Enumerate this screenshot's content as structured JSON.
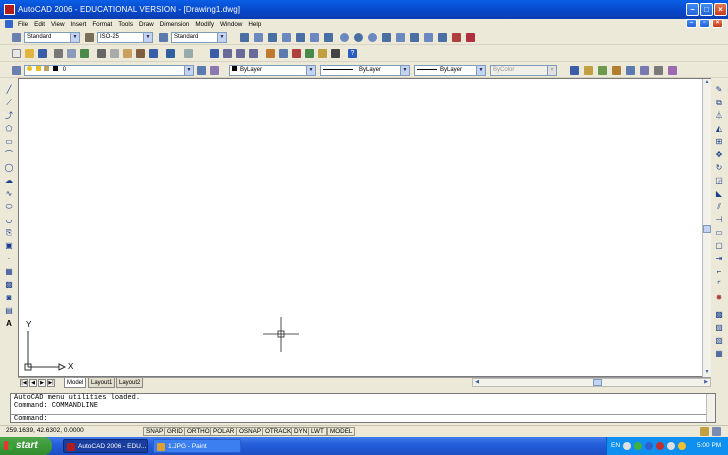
{
  "window": {
    "title": "AutoCAD 2006 - EDUCATIONAL VERSION - [Drawing1.dwg]"
  },
  "menu": [
    "File",
    "Edit",
    "View",
    "Insert",
    "Format",
    "Tools",
    "Draw",
    "Dimension",
    "Modify",
    "Window",
    "Help"
  ],
  "styles": {
    "text_style": "Standard",
    "dim_style": "ISO-25",
    "table_style": "Standard"
  },
  "layers": {
    "current": "0"
  },
  "properties": {
    "color": "ByLayer",
    "linetype": "ByLayer",
    "lineweight": "ByLayer",
    "plotstyle": "ByColor"
  },
  "ucs": {
    "y_label": "Y",
    "x_label": "X"
  },
  "tabs": [
    "Model",
    "Layout1",
    "Layout2"
  ],
  "command": {
    "history": [
      "AutoCAD menu utilities loaded.",
      "Command: COMMANDLINE"
    ],
    "prompt": "Command:"
  },
  "status": {
    "coords": "259.1639, 42.6302, 0.0000",
    "toggles": [
      "SNAP",
      "GRID",
      "ORTHO",
      "POLAR",
      "OSNAP",
      "OTRACK",
      "DYN",
      "LWT",
      "MODEL"
    ]
  },
  "taskbar": {
    "start": "start",
    "tasks": [
      "AutoCAD 2006 - EDU...",
      "1.JPG - Paint"
    ],
    "lang": "EN",
    "clock": "5:00 PM"
  },
  "icons": {
    "window_minimize": "minimize-icon",
    "window_maximize": "maximize-icon",
    "window_close": "close-icon"
  }
}
